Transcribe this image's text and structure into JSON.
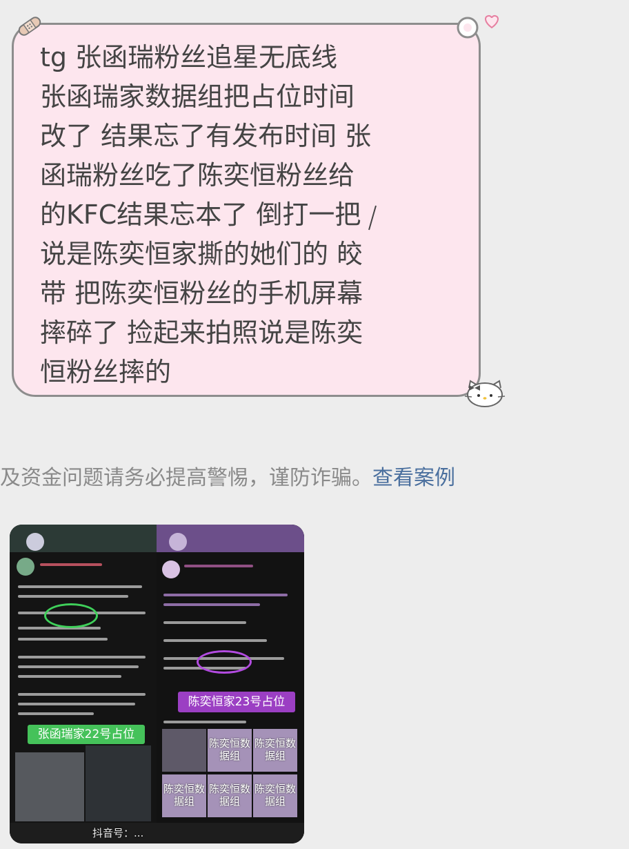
{
  "bubble": {
    "lines": [
      "tg  张函瑞粉丝追星无底线",
      "张函瑞家数据组把占位时间",
      "改了 结果忘了有发布时间 张",
      "函瑞粉丝吃了陈奕恒粉丝给",
      "的KFC结果忘本了 倒打一把",
      "说是陈奕恒家撕的她们的 皎",
      "带 把陈奕恒粉丝的手机屏幕",
      "摔碎了 捡起来拍照说是陈奕",
      "恒粉丝摔的"
    ],
    "bg_color": "#fde6ee",
    "border_color": "#8d8d8d"
  },
  "notice": {
    "text": "及资金问题请务必提高警惕，谨防诈骗。",
    "link_label": "查看案例",
    "link_color": "#4a6f9e"
  },
  "image_message": {
    "left_badge": "张函瑞家22号占位",
    "right_badge": "陈奕恒家23号占位",
    "tile_label": "陈奕恒数据组",
    "watermark": "抖音号：..."
  }
}
